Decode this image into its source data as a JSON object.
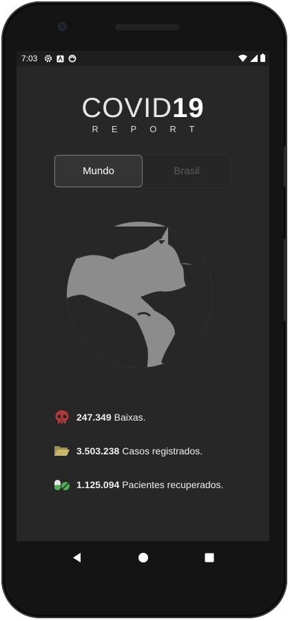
{
  "status_bar": {
    "time": "7:03",
    "left_icons": [
      "gear-icon",
      "accessibility-icon",
      "sync-icon"
    ],
    "right_icons": [
      "wifi-icon",
      "signal-icon",
      "battery-icon"
    ]
  },
  "logo": {
    "title_thin": "COVID",
    "title_bold": "19",
    "subtitle": "REPORT"
  },
  "toggle": {
    "tabs": [
      {
        "label": "Mundo",
        "active": true
      },
      {
        "label": "Brasil",
        "active": false
      }
    ]
  },
  "stats": [
    {
      "icon": "skull-icon",
      "value": "247.349",
      "label": "Baixas.",
      "color": "#c0392b"
    },
    {
      "icon": "folder-icon",
      "value": "3.503.238",
      "label": "Casos registrados.",
      "color": "#c9b86a"
    },
    {
      "icon": "pills-icon",
      "value": "1.125.094",
      "label": "Pacientes recuperados.",
      "color": "#4caf50"
    }
  ],
  "nav": {
    "back": "back-icon",
    "home": "home-icon",
    "recents": "recents-icon"
  },
  "colors": {
    "screen_bg": "#272727",
    "globe": "#8c8c8c"
  }
}
